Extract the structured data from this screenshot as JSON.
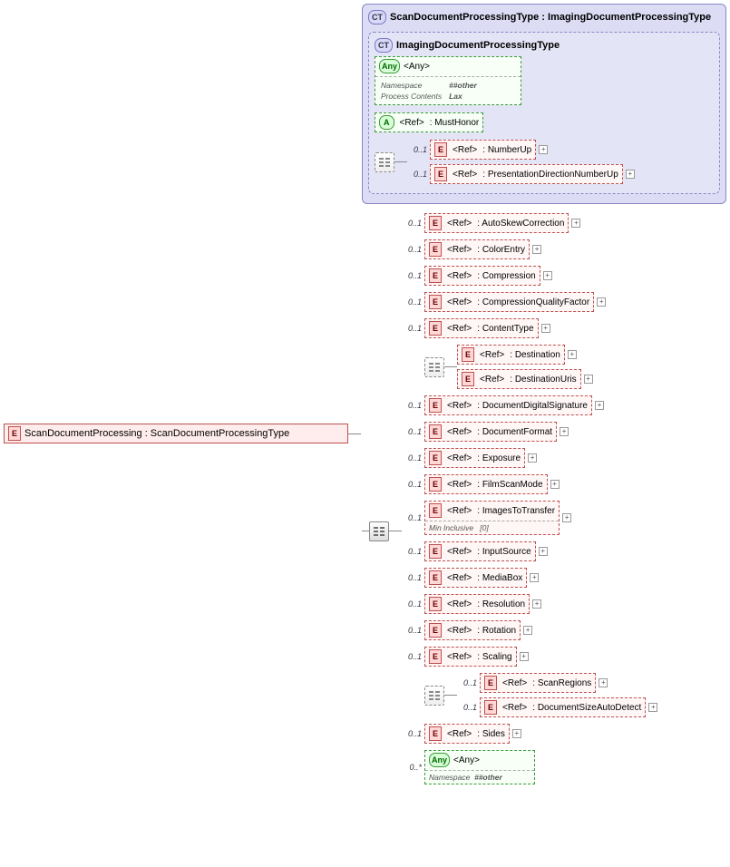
{
  "root": {
    "badge": "E",
    "label": "ScanDocumentProcessing : ScanDocumentProcessingType"
  },
  "frame_outer": {
    "badge": "CT",
    "title": "ScanDocumentProcessingType : ImagingDocumentProcessingType"
  },
  "frame_inner": {
    "badge": "CT",
    "title": "ImagingDocumentProcessingType"
  },
  "inner_any": {
    "badge": "Any",
    "label": "<Any>",
    "ns_label": "Namespace",
    "ns_val": "##other",
    "pc_label": "Process Contents",
    "pc_val": "Lax"
  },
  "must_honor": {
    "badge": "A",
    "ref": "<Ref>",
    "name": ": MustHonor"
  },
  "card01": "0..1",
  "card0s": "0..*",
  "inner_refs": [
    {
      "ref": "<Ref>",
      "name": ": NumberUp"
    },
    {
      "ref": "<Ref>",
      "name": ": PresentationDirectionNumberUp"
    }
  ],
  "main_refs_a": [
    {
      "ref": "<Ref>",
      "name": ": AutoSkewCorrection"
    },
    {
      "ref": "<Ref>",
      "name": ": ColorEntry"
    },
    {
      "ref": "<Ref>",
      "name": ": Compression"
    },
    {
      "ref": "<Ref>",
      "name": ": CompressionQualityFactor"
    },
    {
      "ref": "<Ref>",
      "name": ": ContentType"
    }
  ],
  "group_dest": [
    {
      "ref": "<Ref>",
      "name": ": Destination"
    },
    {
      "ref": "<Ref>",
      "name": ": DestinationUris"
    }
  ],
  "main_refs_b1": [
    {
      "ref": "<Ref>",
      "name": ": DocumentDigitalSignature"
    },
    {
      "ref": "<Ref>",
      "name": ": DocumentFormat"
    },
    {
      "ref": "<Ref>",
      "name": ": Exposure"
    },
    {
      "ref": "<Ref>",
      "name": ": FilmScanMode"
    }
  ],
  "images_to_transfer": {
    "ref": "<Ref>",
    "name": ": ImagesToTransfer",
    "meta_label": "Min Inclusive",
    "meta_val": "[0]"
  },
  "main_refs_b2": [
    {
      "ref": "<Ref>",
      "name": ": InputSource"
    },
    {
      "ref": "<Ref>",
      "name": ": MediaBox"
    },
    {
      "ref": "<Ref>",
      "name": ": Resolution"
    },
    {
      "ref": "<Ref>",
      "name": ": Rotation"
    },
    {
      "ref": "<Ref>",
      "name": ": Scaling"
    }
  ],
  "group_scan": [
    {
      "ref": "<Ref>",
      "name": ": ScanRegions"
    },
    {
      "ref": "<Ref>",
      "name": ": DocumentSizeAutoDetect"
    }
  ],
  "sides": {
    "ref": "<Ref>",
    "name": ": Sides"
  },
  "tail_any": {
    "badge": "Any",
    "label": "<Any>",
    "ns_label": "Namespace",
    "ns_val": "##other"
  }
}
